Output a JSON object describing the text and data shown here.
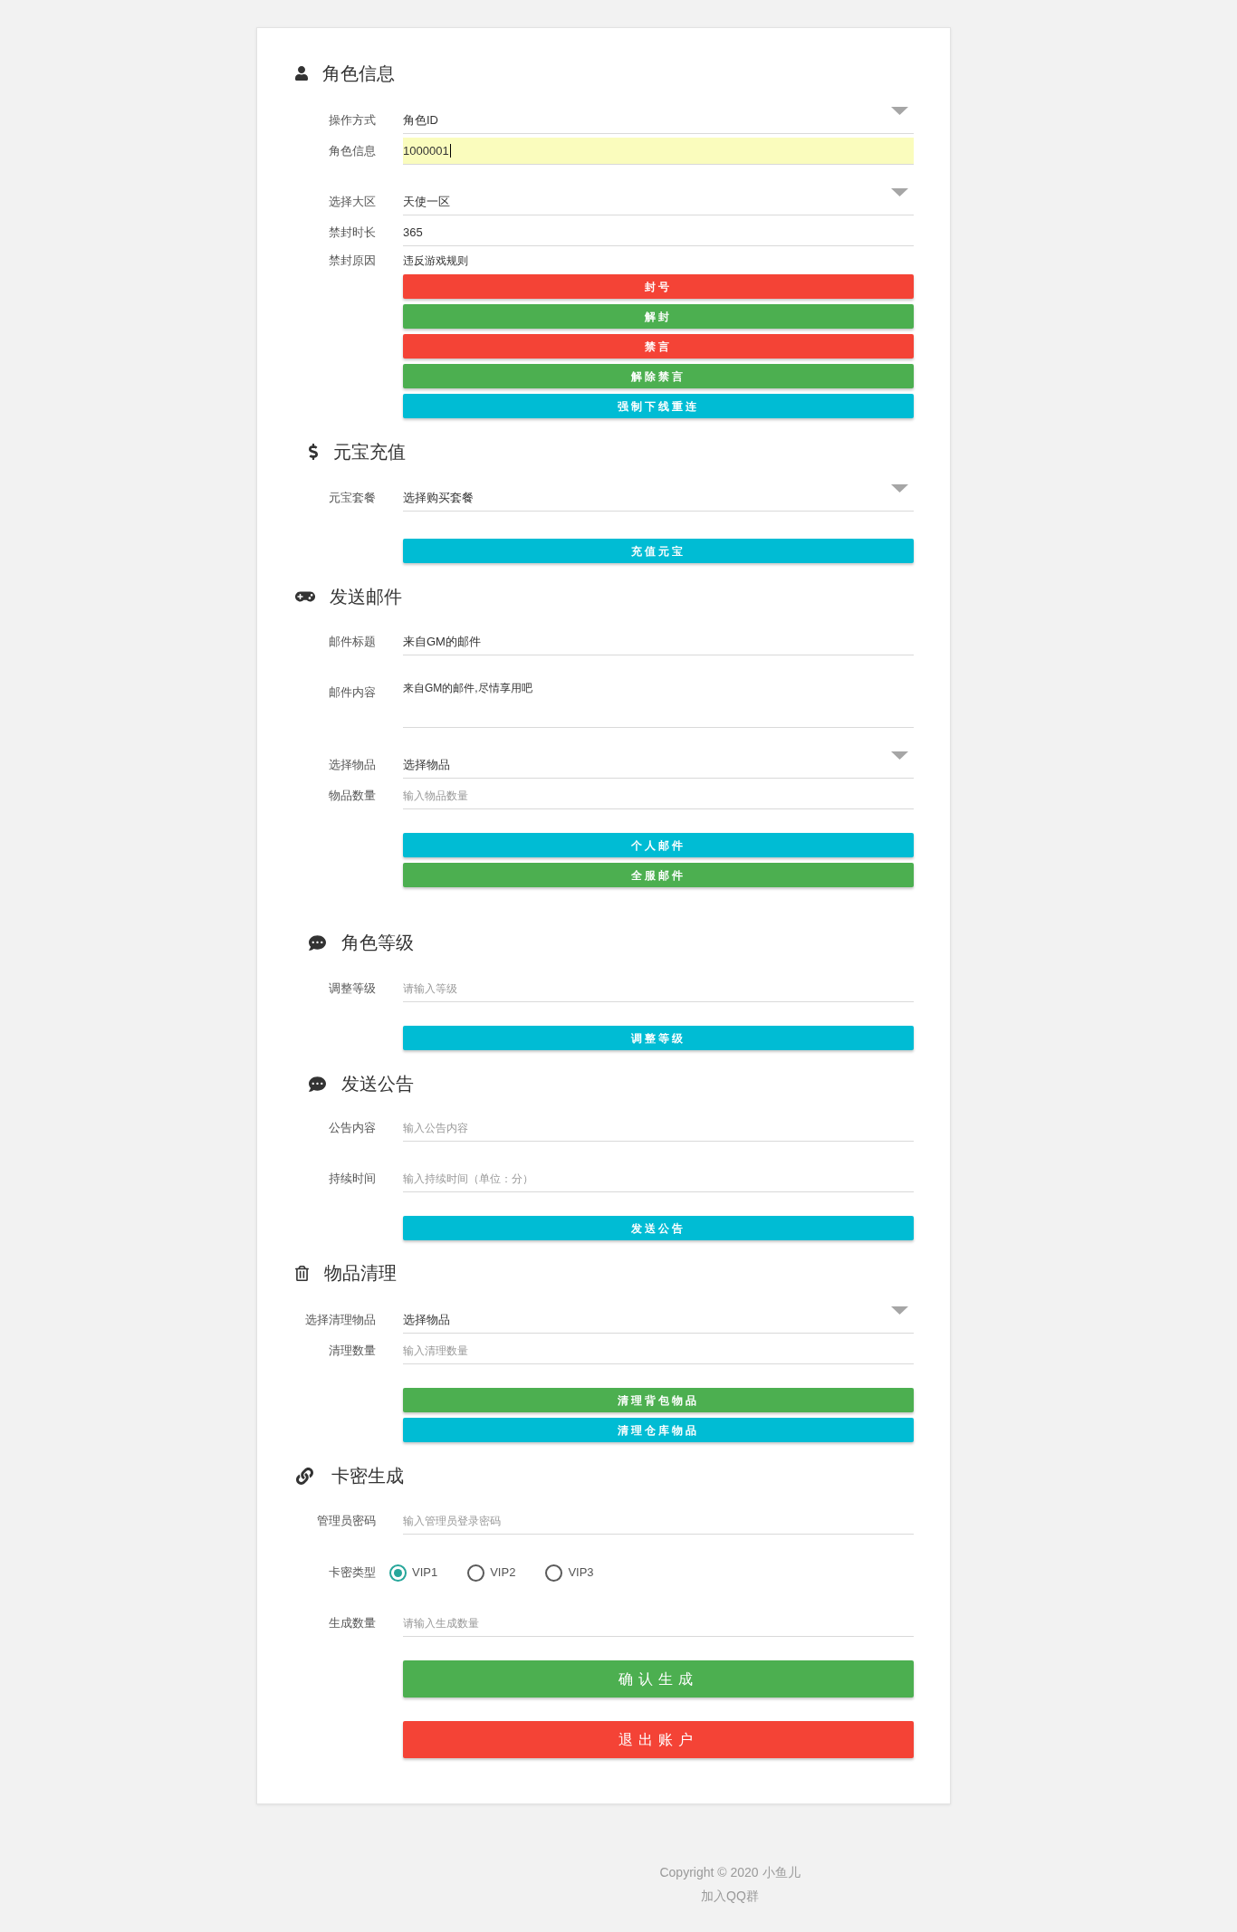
{
  "sections": [
    {
      "title": "角色信息",
      "rows": [
        {
          "kind": "select",
          "label": "操作方式",
          "value": "角色ID"
        },
        {
          "kind": "input",
          "label": "角色信息",
          "value": "1000001",
          "autofilled": true,
          "focused": true
        },
        {
          "kind": "select",
          "label": "选择大区",
          "value": "天使一区"
        },
        {
          "kind": "input",
          "label": "禁封时长",
          "value": "365",
          "autofilled": false,
          "focused": false
        },
        {
          "kind": "plain",
          "label": "禁封原因",
          "value": "违反游戏规则",
          "autofilled": false,
          "focused": false
        }
      ],
      "buttons": [
        {
          "kind": "small",
          "label": "封号",
          "color": "#f44336"
        },
        {
          "kind": "small",
          "label": "解封",
          "color": "#4caf50"
        },
        {
          "kind": "small",
          "label": "禁言",
          "color": "#f44336"
        },
        {
          "kind": "small",
          "label": "解除禁言",
          "color": "#4caf50"
        },
        {
          "kind": "small",
          "label": "强制下线重连",
          "color": "#00bcd4"
        }
      ]
    },
    {
      "title": "元宝充值",
      "rows": [
        {
          "kind": "select",
          "label": "元宝套餐",
          "value": "选择购买套餐"
        }
      ],
      "buttons": [
        {
          "kind": "small",
          "label": "充值元宝",
          "color": "#00bcd4"
        }
      ]
    },
    {
      "title": "发送邮件",
      "rows": [
        {
          "kind": "input",
          "label": "邮件标题",
          "value": "来自GM的邮件",
          "autofilled": false,
          "focused": false
        },
        {
          "kind": "textarea",
          "label": "邮件内容",
          "value": "来自GM的邮件,尽情享用吧",
          "autofilled": false,
          "focused": false
        },
        {
          "kind": "select",
          "label": "选择物品",
          "value": "选择物品"
        },
        {
          "kind": "input",
          "label": "物品数量",
          "placeholder": "输入物品数量",
          "autofilled": false,
          "focused": false
        }
      ],
      "buttons": [
        {
          "kind": "small",
          "label": "个人邮件",
          "color": "#00bcd4"
        },
        {
          "kind": "small",
          "label": "全服邮件",
          "color": "#4caf50"
        }
      ]
    },
    {
      "title": "角色等级",
      "rows": [
        {
          "kind": "input",
          "label": "调整等级",
          "placeholder": "请输入等级",
          "autofilled": false,
          "focused": false
        }
      ],
      "buttons": [
        {
          "kind": "small",
          "label": "调整等级",
          "color": "#00bcd4"
        }
      ]
    },
    {
      "title": "发送公告",
      "rows": [
        {
          "kind": "input",
          "label": "公告内容",
          "placeholder": "输入公告内容",
          "autofilled": false,
          "focused": false
        },
        {
          "kind": "input",
          "label": "持续时间",
          "placeholder": "输入持续时间（单位：分）",
          "autofilled": false,
          "focused": false
        }
      ],
      "buttons": [
        {
          "kind": "small",
          "label": "发送公告",
          "color": "#00bcd4"
        }
      ]
    },
    {
      "title": "物品清理",
      "rows": [
        {
          "kind": "select",
          "label": "选择清理物品",
          "value": "选择物品"
        },
        {
          "kind": "input",
          "label": "清理数量",
          "placeholder": "输入清理数量",
          "autofilled": false,
          "focused": false
        }
      ],
      "buttons": [
        {
          "kind": "small",
          "label": "清理背包物品",
          "color": "#4caf50"
        },
        {
          "kind": "small",
          "label": "清理仓库物品",
          "color": "#00bcd4"
        }
      ]
    },
    {
      "title": "卡密生成",
      "rows": [
        {
          "kind": "input",
          "label": "管理员密码",
          "placeholder": "输入管理员登录密码",
          "autofilled": false,
          "focused": false
        },
        {
          "kind": "radio",
          "label": "卡密类型",
          "options": [
            {
              "label": "VIP1",
              "selected": true
            },
            {
              "label": "VIP2",
              "selected": false
            },
            {
              "label": "VIP3",
              "selected": false
            }
          ]
        },
        {
          "kind": "input",
          "label": "生成数量",
          "placeholder": "请输入生成数量",
          "autofilled": false,
          "focused": false
        }
      ],
      "buttons": [
        {
          "kind": "large",
          "label": "确认生成",
          "color": "#4caf50"
        },
        {
          "kind": "large",
          "label": "退出账户",
          "color": "#f44336"
        }
      ]
    }
  ],
  "footer": {
    "copyright": "Copyright © 2020 小鱼儿",
    "link": "加入QQ群"
  }
}
